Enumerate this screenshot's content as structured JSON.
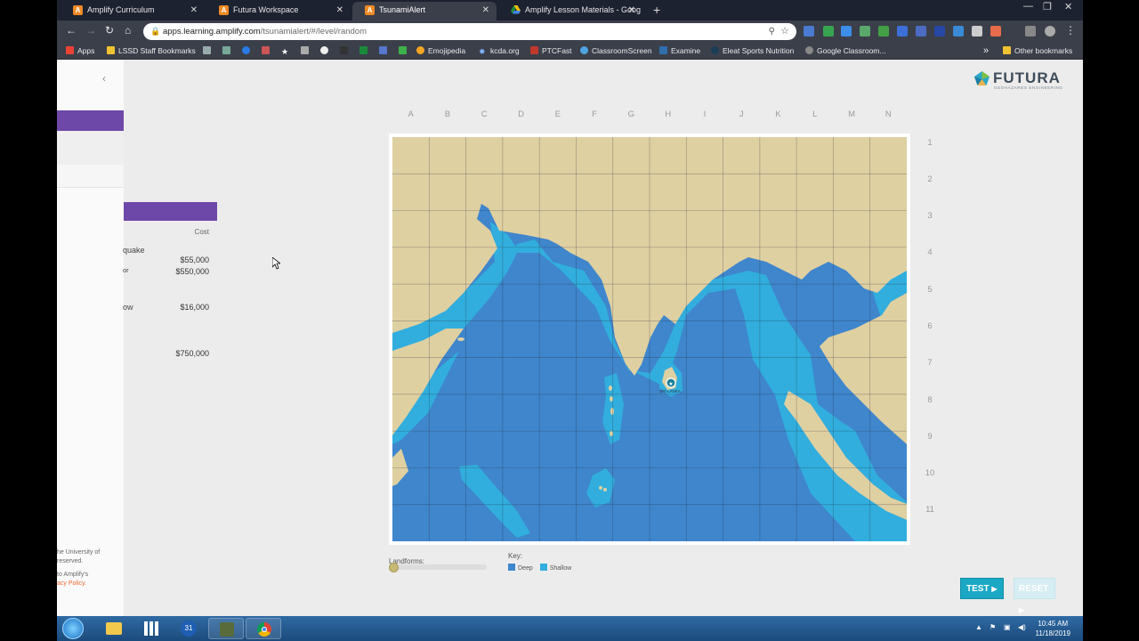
{
  "browser": {
    "tabs": [
      {
        "title": "Amplify Curriculum",
        "active": false
      },
      {
        "title": "Futura Workspace",
        "active": false
      },
      {
        "title": "TsunamiAlert",
        "active": true
      },
      {
        "title": "Amplify Lesson Materials - Goog",
        "active": false
      }
    ],
    "url_host": "apps.learning.amplify.com",
    "url_path": "/tsunamialert/#/level/random",
    "bookmarks": [
      "Apps",
      "LSSD Staff Bookmarks",
      "Emojipedia",
      "kcda.org",
      "PTCFast",
      "ClassroomScreen",
      "Examine",
      "Eleat Sports Nutrition",
      "Google Classroom..."
    ],
    "other_bookmarks": "Other bookmarks",
    "overflow": "»"
  },
  "logo": {
    "name": "FUTURA",
    "tagline": "GEOHAZARDS ENGINEERING"
  },
  "cost_panel": {
    "column_header": "Cost",
    "items": [
      {
        "label": "quake",
        "price": "$55,000"
      },
      {
        "label": "or",
        "price": "$550,000"
      },
      {
        "label": "ow",
        "price": "$16,000"
      },
      {
        "label": "",
        "price": "$750,000"
      }
    ]
  },
  "legal": {
    "line1": "he University of",
    "line2": "reserved.",
    "line3": "to Amplify's",
    "link": "acy Policy."
  },
  "grid": {
    "columns": [
      "A",
      "B",
      "C",
      "D",
      "E",
      "F",
      "G",
      "H",
      "I",
      "J",
      "K",
      "L",
      "M",
      "N"
    ],
    "rows": [
      "1",
      "2",
      "3",
      "4",
      "5",
      "6",
      "7",
      "8",
      "9",
      "10",
      "11"
    ]
  },
  "map": {
    "location_label": "SRI LANKA",
    "colors": {
      "land": "#dfd0a2",
      "shallow": "#31aedd",
      "deep": "#3f86cc"
    }
  },
  "controls": {
    "landforms_label": "Landforms:",
    "landforms_level": 0,
    "key_label": "Key:",
    "key_items": [
      {
        "name": "Deep",
        "color": "#3f86cc"
      },
      {
        "name": "Shallow",
        "color": "#31aedd"
      }
    ],
    "test_button": "TEST",
    "reset_button": "RESET"
  },
  "taskbar": {
    "calendar_day": "31",
    "time": "10:45 AM",
    "date": "11/18/2019"
  }
}
